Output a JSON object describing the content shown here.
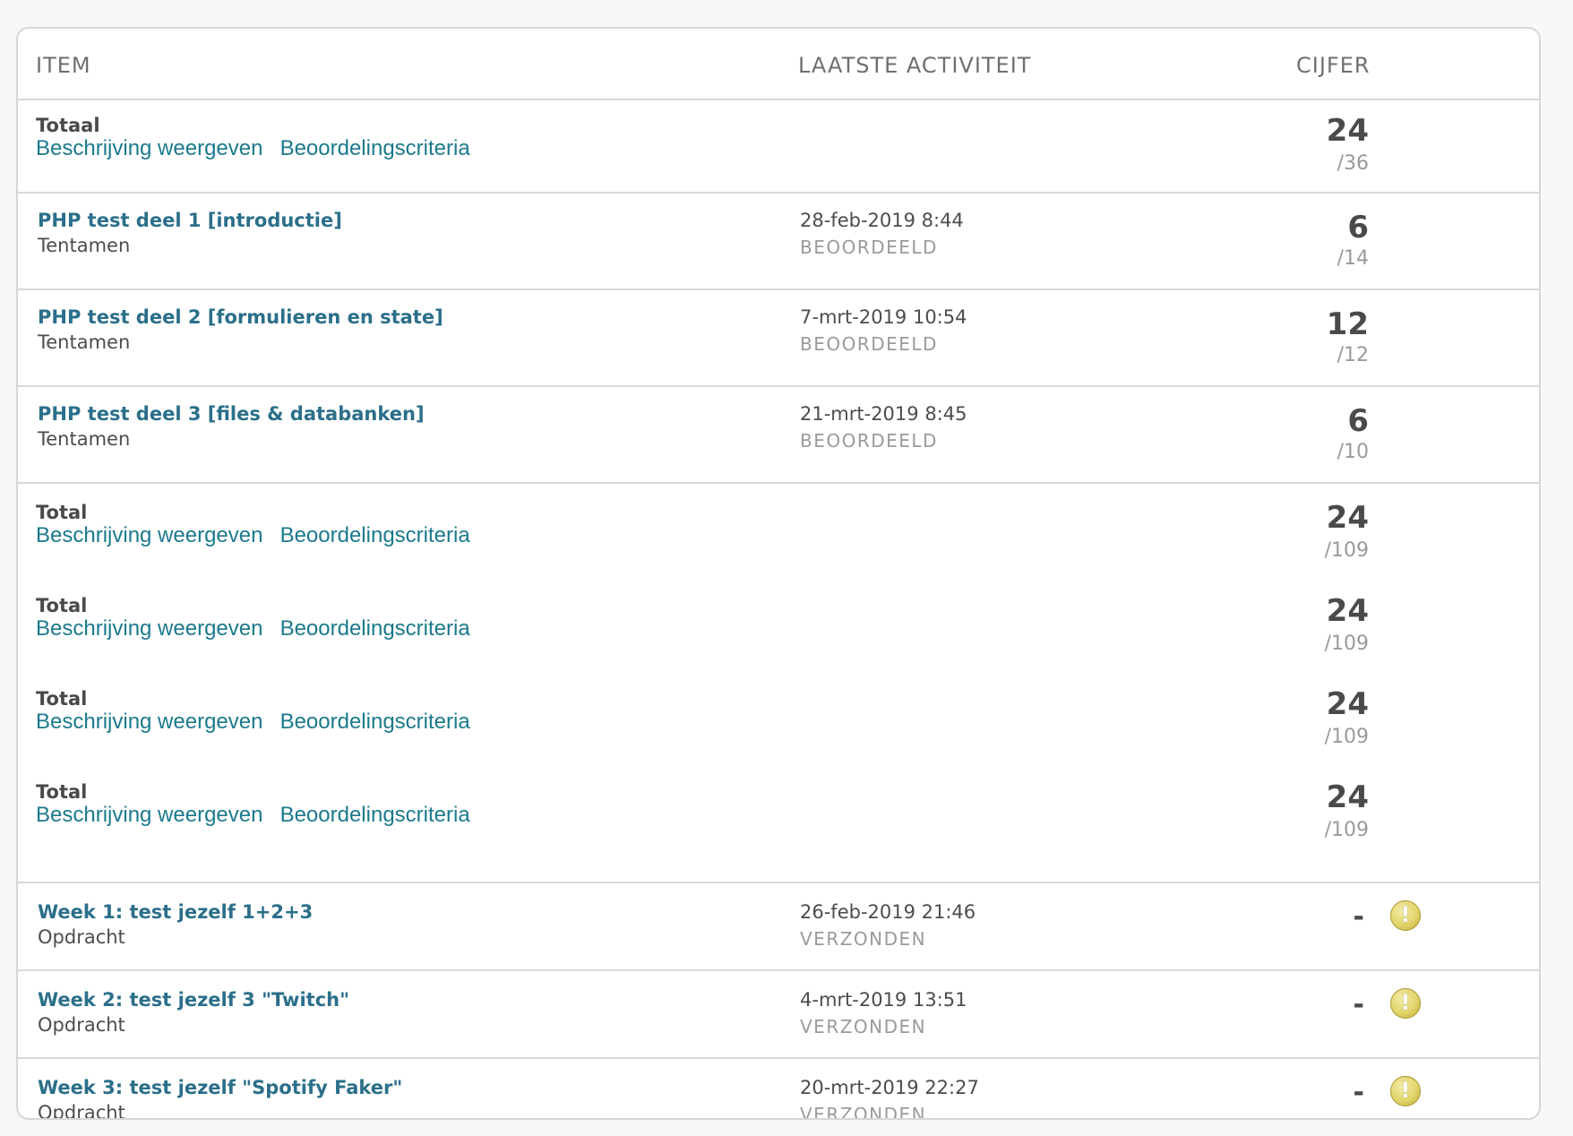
{
  "header": {
    "item": "ITEM",
    "activity": "LAATSTE ACTIVITEIT",
    "grade": "CIJFER"
  },
  "total_rows": [
    {
      "title": "Totaal",
      "link_description": "Beschrijving weergeven",
      "link_criteria": "Beoordelingscriteria",
      "score": "24",
      "out_of": "/36"
    },
    {
      "title": "Total",
      "link_description": "Beschrijving weergeven",
      "link_criteria": "Beoordelingscriteria",
      "score": "24",
      "out_of": "/109"
    },
    {
      "title": "Total",
      "link_description": "Beschrijving weergeven",
      "link_criteria": "Beoordelingscriteria",
      "score": "24",
      "out_of": "/109"
    },
    {
      "title": "Total",
      "link_description": "Beschrijving weergeven",
      "link_criteria": "Beoordelingscriteria",
      "score": "24",
      "out_of": "/109"
    },
    {
      "title": "Total",
      "link_description": "Beschrijving weergeven",
      "link_criteria": "Beoordelingscriteria",
      "score": "24",
      "out_of": "/109"
    }
  ],
  "exams": [
    {
      "title": "PHP test deel 1 [introductie]",
      "type": "Tentamen",
      "date": "28-feb-2019 8:44",
      "status": "BEOORDEELD",
      "score": "6",
      "out_of": "/14"
    },
    {
      "title": "PHP test deel 2 [formulieren en state]",
      "type": "Tentamen",
      "date": "7-mrt-2019 10:54",
      "status": "BEOORDEELD",
      "score": "12",
      "out_of": "/12"
    },
    {
      "title": "PHP test deel 3 [files & databanken]",
      "type": "Tentamen",
      "date": "21-mrt-2019 8:45",
      "status": "BEOORDEELD",
      "score": "6",
      "out_of": "/10"
    }
  ],
  "assignments": [
    {
      "title": "Week 1: test jezelf 1+2+3",
      "type": "Opdracht",
      "date": "26-feb-2019 21:46",
      "status": "VERZONDEN",
      "score": "-",
      "icon": "warning-icon"
    },
    {
      "title": "Week 2: test jezelf 3 \"Twitch\"",
      "type": "Opdracht",
      "date": "4-mrt-2019 13:51",
      "status": "VERZONDEN",
      "score": "-",
      "icon": "warning-icon"
    },
    {
      "title": "Week 3: test jezelf \"Spotify Faker\"",
      "type": "Opdracht",
      "date": "20-mrt-2019 22:27",
      "status": "VERZONDEN",
      "score": "-",
      "icon": "warning-icon"
    }
  ],
  "colors": {
    "link": "#1b7a8c",
    "item_link": "#2b6f8a",
    "warning": "#e2d46a"
  }
}
